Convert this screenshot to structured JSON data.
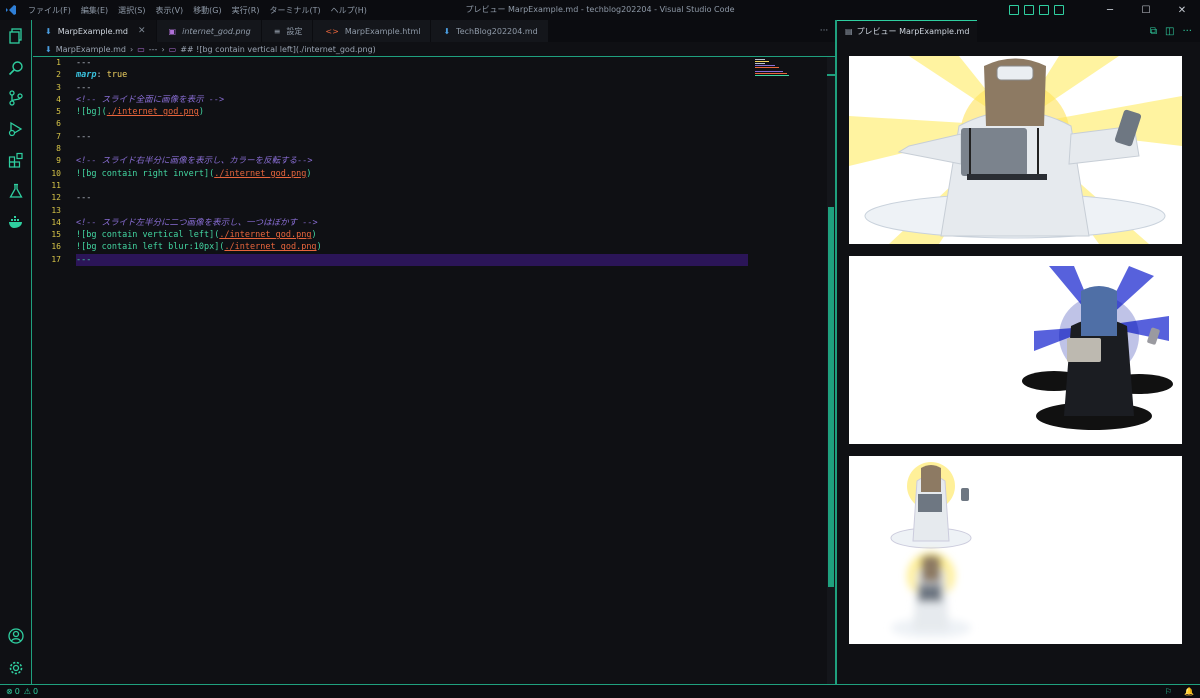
{
  "titlebar": {
    "menus": [
      "ファイル(F)",
      "編集(E)",
      "選択(S)",
      "表示(V)",
      "移動(G)",
      "実行(R)",
      "ターミナル(T)",
      "ヘルプ(H)"
    ],
    "window_title": "プレビュー MarpExample.md - techblog202204 - Visual Studio Code"
  },
  "tabs": [
    {
      "label": "MarpExample.md"
    },
    {
      "label": "internet_god.png"
    },
    {
      "label": "設定"
    },
    {
      "label": "MarpExample.html"
    },
    {
      "label": "TechBlog202204.md"
    }
  ],
  "tab_more": "···",
  "breadcrumb": {
    "file": "MarpExample.md",
    "sep": "›",
    "section1": "---",
    "section2": "## ![bg contain vertical left](./internet_god.png)"
  },
  "code_lines": [
    {
      "n": "1"
    },
    {
      "n": "2"
    },
    {
      "n": "3"
    },
    {
      "n": "4"
    },
    {
      "n": "5"
    },
    {
      "n": "6"
    },
    {
      "n": "7"
    },
    {
      "n": "8"
    },
    {
      "n": "9"
    },
    {
      "n": "10"
    },
    {
      "n": "11"
    },
    {
      "n": "12"
    },
    {
      "n": "13"
    },
    {
      "n": "14"
    },
    {
      "n": "15"
    },
    {
      "n": "16"
    },
    {
      "n": "17"
    }
  ],
  "code": {
    "l1": "---",
    "l2_key": "marp",
    "l2_colon": ": ",
    "l2_val": "true",
    "l3": "---",
    "l4": "<!-- スライド全面に画像を表示 -->",
    "l5_a": "![",
    "l5_alt": "bg",
    "l5_b": "](",
    "l5_url": "./internet_god.png",
    "l5_c": ")",
    "l7": "---",
    "l9": "<!-- スライド右半分に画像を表示し、カラーを反転する-->",
    "l10_a": "![",
    "l10_alt": "bg contain right invert",
    "l10_b": "](",
    "l10_url": "./internet_god.png",
    "l10_c": ")",
    "l12": "---",
    "l14": "<!-- スライド左半分に二つ画像を表示し、一つはぼかす -->",
    "l15_a": "![",
    "l15_alt": "bg contain vertical left",
    "l15_b": "](",
    "l15_url": "./internet_god.png",
    "l15_c": ")",
    "l16_a": "![",
    "l16_alt": "bg contain left blur:10px",
    "l16_b": "](",
    "l16_url": "./internet_god.png",
    "l16_c": ")",
    "l17": "---"
  },
  "preview": {
    "tab_label": "プレビュー MarpExample.md",
    "more": "···"
  },
  "status": {
    "errors": "0",
    "warnings": "0"
  },
  "colors": {
    "accent": "#1fa07e",
    "background": "#0f1014",
    "current_line": "#2b1558"
  }
}
